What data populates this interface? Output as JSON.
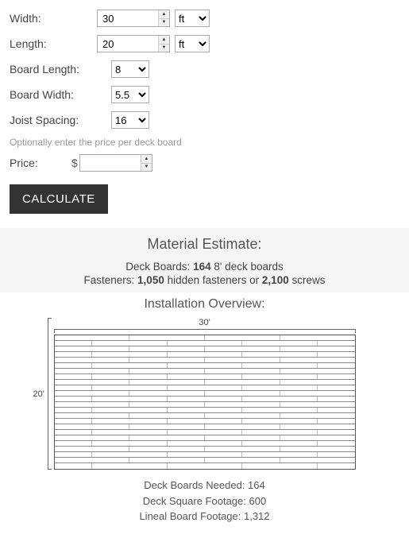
{
  "form": {
    "width_label": "Width:",
    "width_value": "30",
    "width_unit": "ft",
    "length_label": "Length:",
    "length_value": "20",
    "length_unit": "ft",
    "board_length_label": "Board Length:",
    "board_length_value": "8",
    "board_width_label": "Board Width:",
    "board_width_value": "5.5",
    "joist_spacing_label": "Joist Spacing:",
    "joist_spacing_value": "16",
    "price_hint": "Optionally enter the price per deck board",
    "price_label": "Price:",
    "price_currency": "$",
    "price_value": "",
    "calculate_label": "CALCULATE"
  },
  "estimate": {
    "heading": "Material Estimate:",
    "boards_prefix": "Deck Boards: ",
    "boards_count": "164",
    "boards_suffix": " 8' deck boards",
    "fasteners_prefix": "Fasteners: ",
    "hidden_count": "1,050",
    "fasteners_mid": " hidden fasteners or ",
    "screws_count": "2,100",
    "fasteners_suffix": " screws"
  },
  "overview": {
    "heading": "Installation Overview:",
    "dim_top": "30'",
    "dim_left": "20'",
    "stat1": "Deck Boards Needed: 164",
    "stat2": "Deck Square Footage: 600",
    "stat3": "Lineal Board Footage: 1,312"
  },
  "chart_data": {
    "type": "table",
    "title": "Installation Overview",
    "deck_width_ft": 30,
    "deck_length_ft": 20,
    "board_length_ft": 8,
    "board_width_in": 5.5,
    "joist_spacing_in": 16,
    "deck_boards_needed": 164,
    "deck_square_footage": 600,
    "lineal_board_footage": 1312,
    "hidden_fasteners": 1050,
    "screws": 2100
  }
}
